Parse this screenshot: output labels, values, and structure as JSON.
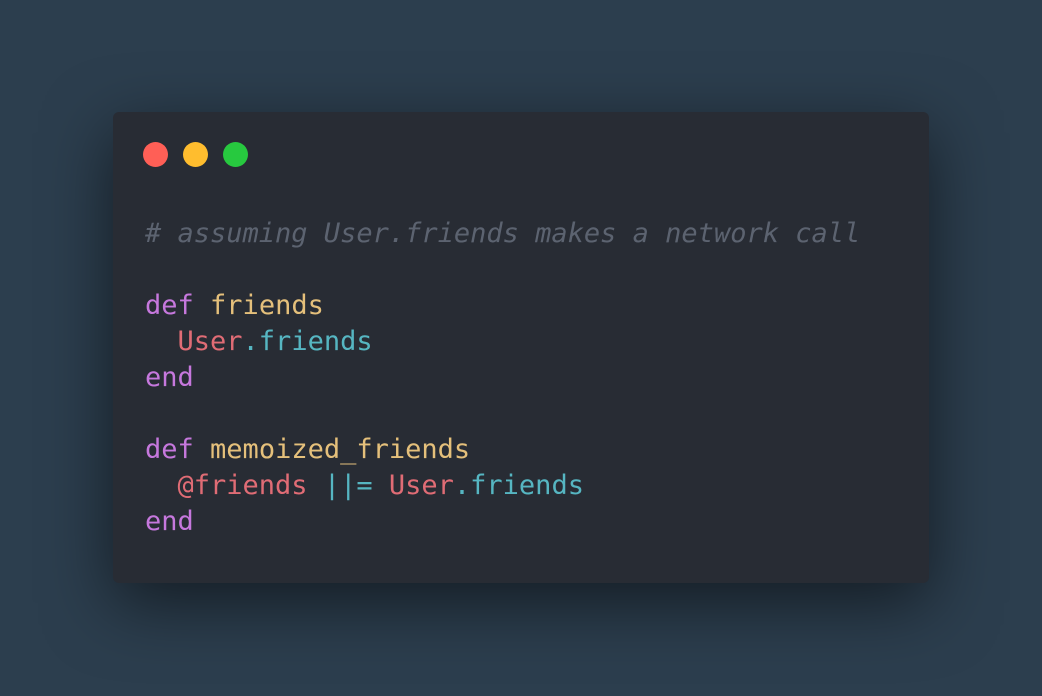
{
  "window": {
    "controls": {
      "close": "red",
      "minimize": "yellow",
      "maximize": "green"
    }
  },
  "code": {
    "comment": "# assuming User.friends makes a network call",
    "def1_keyword": "def",
    "def1_name": "friends",
    "line3_const": "User",
    "line3_method": ".friends",
    "end1": "end",
    "def2_keyword": "def",
    "def2_name": "memoized_friends",
    "line7_ivar": "@friends",
    "line7_op": "||=",
    "line7_const": "User",
    "line7_method": ".friends",
    "end2": "end"
  },
  "colors": {
    "background": "#2c3e4e",
    "window": "#282c34",
    "comment": "#5c6370",
    "keyword": "#c678dd",
    "function": "#e5c07b",
    "constant": "#e06c75",
    "method": "#56b6c2"
  }
}
